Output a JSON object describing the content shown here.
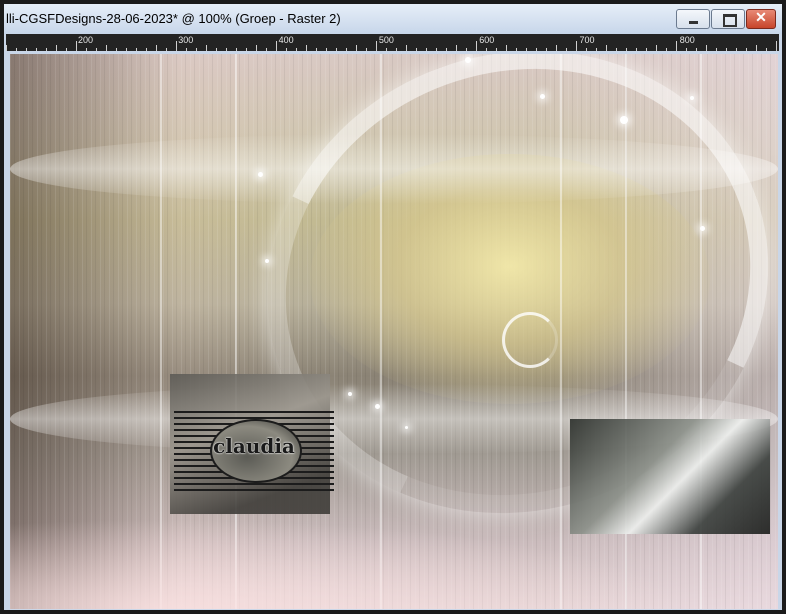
{
  "window": {
    "title": "lli-CGSFDesigns-28-06-2023* @ 100% (Groep - Raster 2)",
    "controls": {
      "minimize_icon": "minimize-icon",
      "maximize_icon": "maximize-icon",
      "close_icon": "close-icon",
      "close_glyph": "✕"
    }
  },
  "ruler": {
    "labels": [
      "200",
      "300",
      "400",
      "500",
      "600",
      "700",
      "800"
    ]
  },
  "canvas": {
    "watermark_text": "claudia",
    "colors": {
      "accent_gold": "#d9c98a",
      "accent_rose": "#c9a3a3",
      "close_red": "#c7452b"
    }
  }
}
